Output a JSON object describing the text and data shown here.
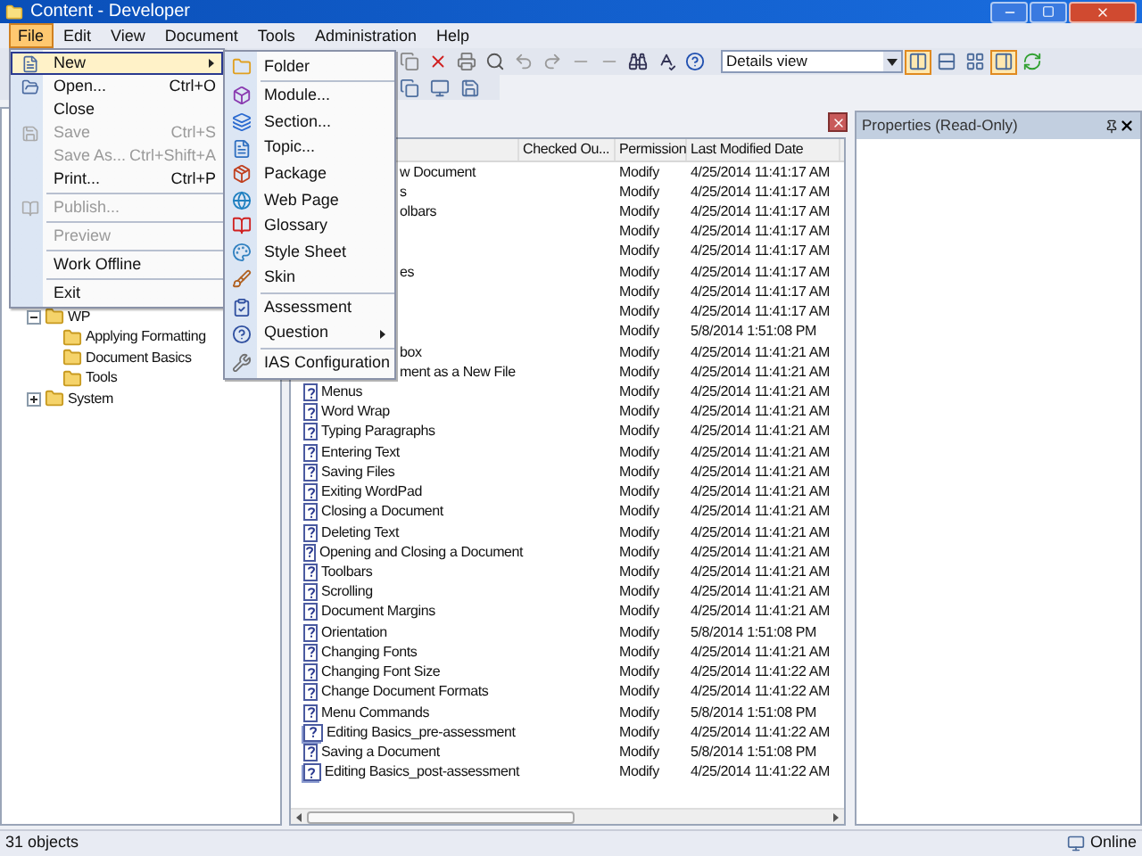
{
  "window": {
    "title": "Content - Developer"
  },
  "menu_bar": [
    {
      "label": "File",
      "selected": true
    },
    {
      "label": "Edit",
      "selected": false
    },
    {
      "label": "View",
      "selected": false
    },
    {
      "label": "Document",
      "selected": false
    },
    {
      "label": "Tools",
      "selected": false
    },
    {
      "label": "Administration",
      "selected": false
    },
    {
      "label": "Help",
      "selected": false
    }
  ],
  "toolbar": {
    "view_combo": {
      "value": "Details view"
    },
    "view_buttons": [
      {
        "selected": true
      },
      {
        "selected": false
      },
      {
        "selected": false
      },
      {
        "selected": true
      }
    ]
  },
  "file_menu": [
    {
      "kind": "item",
      "label": "New",
      "submenu": true,
      "selected": true,
      "disabled": false
    },
    {
      "kind": "item",
      "label": "Open...",
      "shortcut": "Ctrl+O",
      "selected": false,
      "disabled": false
    },
    {
      "kind": "item",
      "label": "Close",
      "selected": false,
      "disabled": false
    },
    {
      "kind": "item",
      "label": "Save",
      "shortcut": "Ctrl+S",
      "selected": false,
      "disabled": true
    },
    {
      "kind": "item",
      "label": "Save As...",
      "shortcut": "Ctrl+Shift+A",
      "selected": false,
      "disabled": true
    },
    {
      "kind": "item",
      "label": "Print...",
      "shortcut": "Ctrl+P",
      "selected": false,
      "disabled": false
    },
    {
      "kind": "separator"
    },
    {
      "kind": "item",
      "label": "Publish...",
      "selected": false,
      "disabled": true
    },
    {
      "kind": "separator"
    },
    {
      "kind": "item",
      "label": "Preview",
      "selected": false,
      "disabled": true
    },
    {
      "kind": "separator"
    },
    {
      "kind": "item",
      "label": "Work Offline",
      "selected": false,
      "disabled": false
    },
    {
      "kind": "separator"
    },
    {
      "kind": "item",
      "label": "Exit",
      "selected": false,
      "disabled": false
    }
  ],
  "new_submenu": [
    {
      "kind": "item",
      "label": "Folder"
    },
    {
      "kind": "separator"
    },
    {
      "kind": "item",
      "label": "Module..."
    },
    {
      "kind": "item",
      "label": "Section..."
    },
    {
      "kind": "item",
      "label": "Topic..."
    },
    {
      "kind": "item",
      "label": "Package"
    },
    {
      "kind": "item",
      "label": "Web Page"
    },
    {
      "kind": "item",
      "label": "Glossary"
    },
    {
      "kind": "item",
      "label": "Style Sheet"
    },
    {
      "kind": "item",
      "label": "Skin"
    },
    {
      "kind": "separator"
    },
    {
      "kind": "item",
      "label": "Assessment"
    },
    {
      "kind": "item",
      "label": "Question",
      "submenu": true
    },
    {
      "kind": "separator"
    },
    {
      "kind": "item",
      "label": "IAS Configuration"
    }
  ],
  "tree": [
    {
      "label": "WP",
      "expanded": true,
      "children": [
        {
          "label": "Applying Formatting"
        },
        {
          "label": "Document Basics"
        },
        {
          "label": "Tools"
        }
      ]
    },
    {
      "label": "System",
      "expanded": false
    }
  ],
  "table": {
    "columns": [
      "Checked Ou...",
      "Permission",
      "Last Modified Date"
    ],
    "rows": [
      {
        "name": "w Document",
        "clipped": true,
        "permission": "Modify",
        "modified": "4/25/2014 11:41:17 AM"
      },
      {
        "name": "s",
        "clipped": true,
        "permission": "Modify",
        "modified": "4/25/2014 11:41:17 AM"
      },
      {
        "name": "olbars",
        "clipped": true,
        "permission": "Modify",
        "modified": "4/25/2014 11:41:17 AM"
      },
      {
        "permission": "Modify",
        "modified": "4/25/2014 11:41:17 AM"
      },
      {
        "permission": "Modify",
        "modified": "4/25/2014 11:41:17 AM"
      },
      {
        "name": "es",
        "clipped": true,
        "permission": "Modify",
        "modified": "4/25/2014 11:41:17 AM"
      },
      {
        "permission": "Modify",
        "modified": "4/25/2014 11:41:17 AM"
      },
      {
        "permission": "Modify",
        "modified": "4/25/2014 11:41:17 AM"
      },
      {
        "permission": "Modify",
        "modified": "5/8/2014 1:51:08 PM"
      },
      {
        "name": "box",
        "clipped": true,
        "permission": "Modify",
        "modified": "4/25/2014 11:41:21 AM"
      },
      {
        "name": "ment as a New File",
        "clipped": true,
        "permission": "Modify",
        "modified": "4/25/2014 11:41:21 AM"
      },
      {
        "kind": "topic",
        "name": "Menus",
        "clipped": false,
        "permission": "Modify",
        "modified": "4/25/2014 11:41:21 AM"
      },
      {
        "kind": "topic",
        "name": "Word Wrap",
        "clipped": false,
        "permission": "Modify",
        "modified": "4/25/2014 11:41:21 AM"
      },
      {
        "kind": "topic",
        "name": "Typing Paragraphs",
        "clipped": false,
        "permission": "Modify",
        "modified": "4/25/2014 11:41:21 AM"
      },
      {
        "kind": "topic",
        "name": "Entering Text",
        "clipped": false,
        "permission": "Modify",
        "modified": "4/25/2014 11:41:21 AM"
      },
      {
        "kind": "topic",
        "name": "Saving Files",
        "clipped": false,
        "permission": "Modify",
        "modified": "4/25/2014 11:41:21 AM"
      },
      {
        "kind": "topic",
        "name": "Exiting WordPad",
        "clipped": false,
        "permission": "Modify",
        "modified": "4/25/2014 11:41:21 AM"
      },
      {
        "kind": "topic",
        "name": "Closing a Document",
        "clipped": false,
        "permission": "Modify",
        "modified": "4/25/2014 11:41:21 AM"
      },
      {
        "kind": "topic",
        "name": "Deleting Text",
        "clipped": false,
        "permission": "Modify",
        "modified": "4/25/2014 11:41:21 AM"
      },
      {
        "kind": "topic",
        "name": "Opening and Closing a Document",
        "clipped": false,
        "permission": "Modify",
        "modified": "4/25/2014 11:41:21 AM"
      },
      {
        "kind": "topic",
        "name": "Toolbars",
        "clipped": false,
        "permission": "Modify",
        "modified": "4/25/2014 11:41:21 AM"
      },
      {
        "kind": "topic",
        "name": "Scrolling",
        "clipped": false,
        "permission": "Modify",
        "modified": "4/25/2014 11:41:21 AM"
      },
      {
        "kind": "topic",
        "name": "Document Margins",
        "clipped": false,
        "permission": "Modify",
        "modified": "4/25/2014 11:41:21 AM"
      },
      {
        "kind": "topic",
        "name": "Orientation",
        "clipped": false,
        "permission": "Modify",
        "modified": "5/8/2014 1:51:08 PM"
      },
      {
        "kind": "topic",
        "name": "Changing Fonts",
        "clipped": false,
        "permission": "Modify",
        "modified": "4/25/2014 11:41:21 AM"
      },
      {
        "kind": "topic",
        "name": "Changing Font Size",
        "clipped": false,
        "permission": "Modify",
        "modified": "4/25/2014 11:41:22 AM"
      },
      {
        "kind": "topic",
        "name": "Change Document Formats",
        "clipped": false,
        "permission": "Modify",
        "modified": "4/25/2014 11:41:22 AM"
      },
      {
        "kind": "topic",
        "name": "Menu Commands",
        "clipped": false,
        "permission": "Modify",
        "modified": "5/8/2014 1:51:08 PM"
      },
      {
        "kind": "assessment",
        "name": "Editing Basics_pre-assessment",
        "clipped": false,
        "permission": "Modify",
        "modified": "4/25/2014 11:41:22 AM"
      },
      {
        "kind": "topic",
        "name": "Saving a Document",
        "clipped": false,
        "permission": "Modify",
        "modified": "5/8/2014 1:51:08 PM"
      },
      {
        "kind": "assessment",
        "name": "Editing Basics_post-assessment",
        "clipped": false,
        "permission": "Modify",
        "modified": "4/25/2014 11:41:22 AM"
      }
    ]
  },
  "properties_panel": {
    "title": "Properties (Read-Only)"
  },
  "status_bar": {
    "count": "31 objects",
    "connection": "Online"
  }
}
